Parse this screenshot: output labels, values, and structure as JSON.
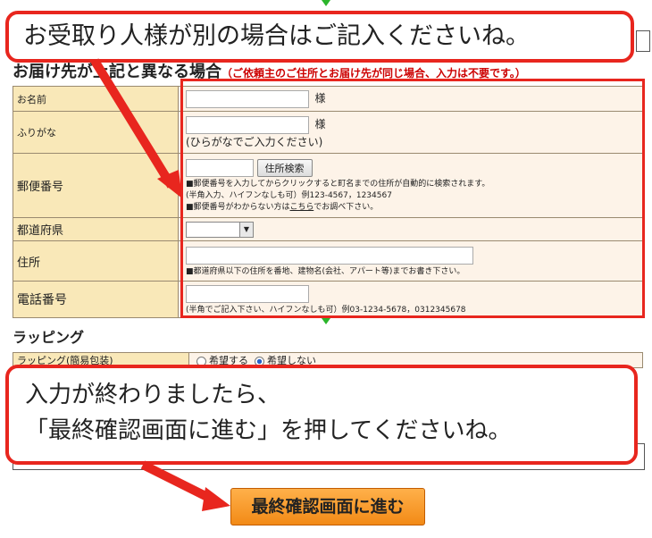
{
  "callouts": {
    "top": "お受取り人様が別の場合はご記入くださいね。",
    "bottom_line1": "入力が終わりましたら、",
    "bottom_line2": "「最終確認画面に進む」を押してくださいね。"
  },
  "section": {
    "title": "お届け先が上記と異なる場合",
    "note": "（ご依頼主のご住所とお届け先が同じ場合、入力は不要です。）"
  },
  "form": {
    "name_label": "お名前",
    "name_suffix": "様",
    "kana_label": "ふりがな",
    "kana_suffix": "様",
    "kana_hint": "(ひらがなでご入力ください)",
    "zip_label": "郵便番号",
    "zip_button": "住所検索",
    "zip_note1": "■郵便番号を入力してからクリックすると町名までの住所が自動的に検索されます。",
    "zip_note2": "(半角入力、ハイフンなしも可）例123-4567，1234567",
    "zip_note3_pre": "■郵便番号がわからない方は",
    "zip_note3_link": "こちら",
    "zip_note3_post": "でお調べ下さい。",
    "pref_label": "都道府県",
    "address_label": "住所",
    "address_note": "■都道府県以下の住所を番地、建物名(会社、アパート等)までお書き下さい。",
    "phone_label": "電話番号",
    "phone_note": "(半角でご記入下さい、ハイフンなしも可）例03-1234-5678，0312345678"
  },
  "wrapping": {
    "title": "ラッピング",
    "label": "ラッピング(簡易包装)",
    "option_yes": "希望する",
    "option_no": "希望しない",
    "selected": "希望しない"
  },
  "final_button": "最終確認画面に進む",
  "colors": {
    "accent_red": "#e8261e",
    "label_bg": "#f9e8b8",
    "value_bg": "#fdf3e8",
    "button_orange": "#f28a16"
  }
}
